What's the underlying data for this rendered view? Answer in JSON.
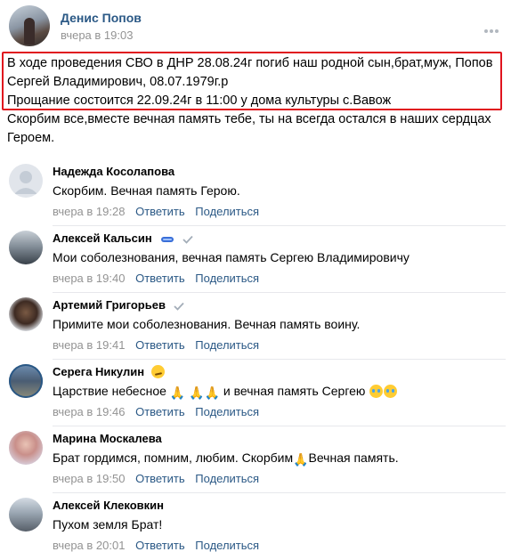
{
  "post": {
    "author": "Денис Попов",
    "time": "вчера в 19:03",
    "lines": [
      "В ходе проведения СВО в ДНР 28.08.24г погиб наш родной сын,брат,муж, Попов",
      "Сергей Владимирович, 08.07.1979г.р",
      "Прощание состоится 22.09.24г в 11:00 у дома культуры с.Вавож",
      "Скорбим все,вместе вечная память тебе, ты на всегда остался в наших сердцах",
      "Героем."
    ]
  },
  "comments": [
    {
      "name": "Надежда Косолапова",
      "text": "Скорбим. Вечная память Герою.",
      "time": "вчера в 19:28",
      "reply": "Ответить",
      "share": "Поделиться"
    },
    {
      "name": "Алексей Кальсин",
      "text": "Мои соболезнования, вечная память Сергею Владимировичу",
      "time": "вчера в 19:40",
      "reply": "Ответить",
      "share": "Поделиться"
    },
    {
      "name": "Артемий Григорьев",
      "text": "Примите мои соболезнования. Вечная память воину.",
      "time": "вчера в 19:41",
      "reply": "Ответить",
      "share": "Поделиться"
    },
    {
      "name": "Серега Никулин",
      "text_a": "Царствие небесное",
      "text_b": "и вечная память Сергею",
      "time": "вчера в 19:46",
      "reply": "Ответить",
      "share": "Поделиться"
    },
    {
      "name": "Марина Москалева",
      "text_a": "Брат гордимся, помним, любим. Скорбим",
      "text_b": "Вечная память.",
      "time": "вчера в 19:50",
      "reply": "Ответить",
      "share": "Поделиться"
    },
    {
      "name": "Алексей Клековкин",
      "text": "Пухом земля Брат!",
      "time": "вчера в 20:01",
      "reply": "Ответить",
      "share": "Поделиться"
    }
  ],
  "icons": {
    "pray": "🙏",
    "more": "more-dots-icon",
    "verified": "verified-check-icon"
  },
  "colors": {
    "link": "#2a5885",
    "muted": "#939393",
    "highlight_border": "#e0141e"
  }
}
